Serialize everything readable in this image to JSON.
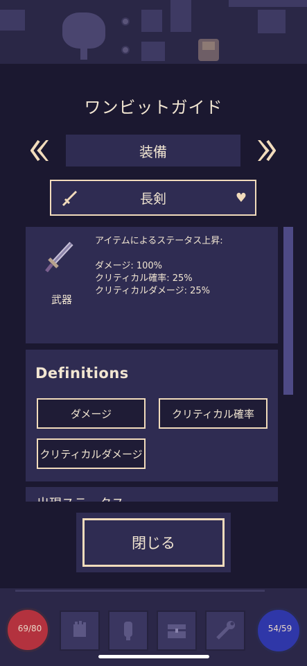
{
  "guide": {
    "title": "ワンビットガイド",
    "category": "装備",
    "item": "長剣"
  },
  "stats_card": {
    "weapon_type": "武器",
    "heading": "アイテムによるステータス上昇:",
    "lines": [
      "ダメージ: 100%",
      "クリティカル確率: 25%",
      "クリティカルダメージ: 25%"
    ]
  },
  "definitions": {
    "title": "Definitions",
    "buttons": [
      "ダメージ",
      "クリティカル確率",
      "クリティカルダメージ"
    ]
  },
  "partial_card": {
    "text": "出現ステータス"
  },
  "close_button": "閉じる",
  "hud": {
    "hp": "69/80",
    "mp": "54/59"
  },
  "colors": {
    "panel": "#1b1830",
    "card": "#2f2c52",
    "border": "#f2dcbc",
    "text": "#f2e6d2",
    "scroll_thumb": "#4e4a86",
    "hp": "#b3323e",
    "mp": "#2f37a8"
  },
  "icons": [
    "chevron-left-icon",
    "chevron-right-icon",
    "sword-icon",
    "heart-icon",
    "hand-icon",
    "bell-icon",
    "chest-icon",
    "wrench-icon"
  ]
}
